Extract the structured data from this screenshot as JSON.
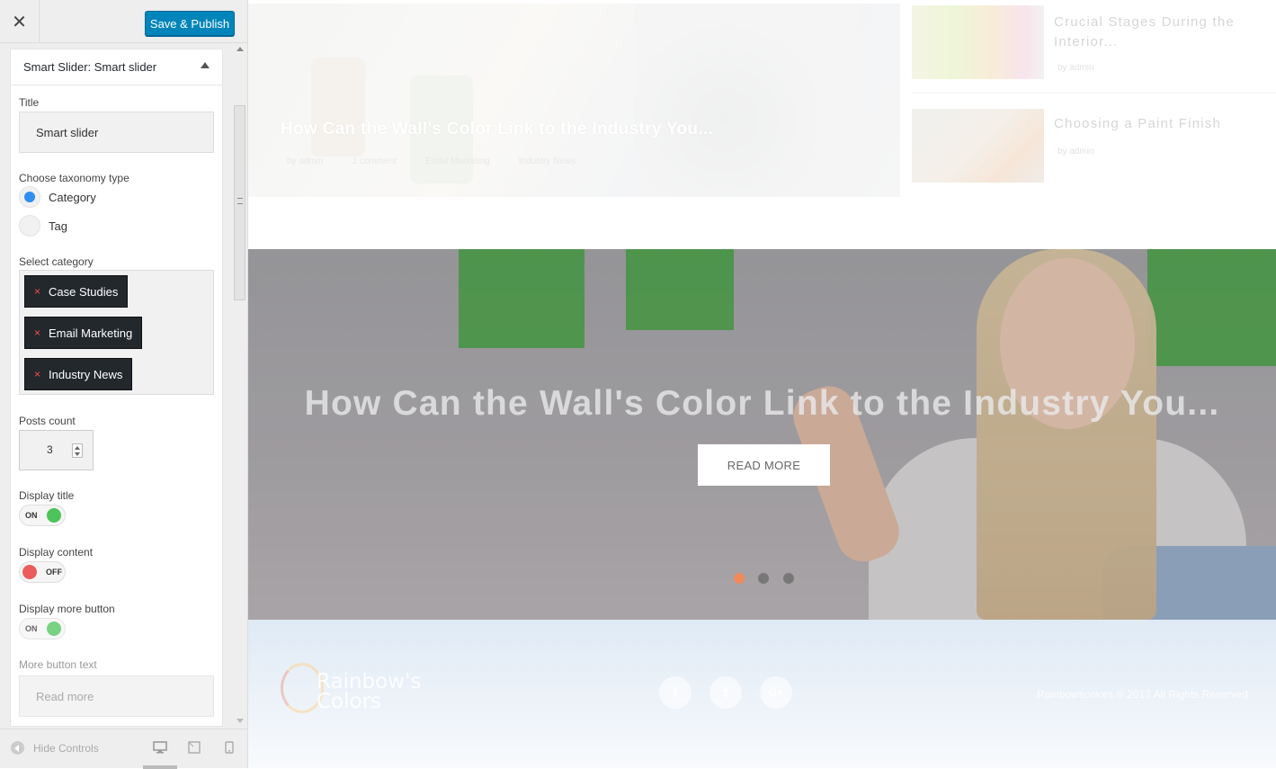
{
  "topbar": {
    "close_glyph": "✕",
    "publish_label": "Save & Publish"
  },
  "widget": {
    "header_prefix": "Smart Slider:",
    "header_name": "Smart slider",
    "title_label": "Title",
    "title_value": "Smart slider",
    "taxonomy_label": "Choose taxonomy type",
    "taxonomy_options": [
      "Category",
      "Tag"
    ],
    "taxonomy_selected": "Category",
    "category_label": "Select category",
    "categories": [
      "Case Studies",
      "Email Marketing",
      "Industry News"
    ],
    "chip_remove_glyph": "×",
    "posts_count_label": "Posts count",
    "posts_count_value": "3",
    "display_title_label": "Display title",
    "display_title_state": "ON",
    "display_content_label": "Display content",
    "display_content_state": "OFF",
    "display_more_label": "Display more button",
    "display_more_state": "ON",
    "more_text_label": "More button text",
    "more_text_value": "Read more"
  },
  "sidebar_footer": {
    "hide_controls_label": "Hide Controls",
    "devices": [
      "desktop-icon",
      "tablet-icon",
      "mobile-icon"
    ],
    "active_device": "desktop"
  },
  "preview": {
    "featured": {
      "title": "How Can the Wall's Color Link to the Industry You...",
      "meta": [
        "by admin",
        "1 comment",
        "Email Marketing",
        "Industry News"
      ]
    },
    "side_posts": [
      {
        "title": "Crucial Stages During the Interior...",
        "by": "by admin"
      },
      {
        "title": "Choosing a Paint Finish",
        "by": "by admin"
      }
    ],
    "slider": {
      "title": "How Can the Wall's Color Link to the Industry You...",
      "button": "READ MORE",
      "dots": 3,
      "active_dot": 1,
      "dot_active_color": "#f08a5d",
      "dot_color": "#666666"
    },
    "footer": {
      "logo_line1": "Rainbow's",
      "logo_line2": "Colors",
      "socials": [
        {
          "name": "facebook-icon",
          "glyph": "f"
        },
        {
          "name": "twitter-icon",
          "glyph": "t"
        },
        {
          "name": "google-plus-icon",
          "glyph": "G+"
        }
      ],
      "copyright": "Rainbowscolors © 2017 All Rights Reserved"
    }
  },
  "colors": {
    "publish": "#0085ba",
    "radio_on": "#2e8ff0",
    "toggle_on": "#4cc35b",
    "toggle_off": "#ec5c5c",
    "chip_bg": "#23282d"
  }
}
